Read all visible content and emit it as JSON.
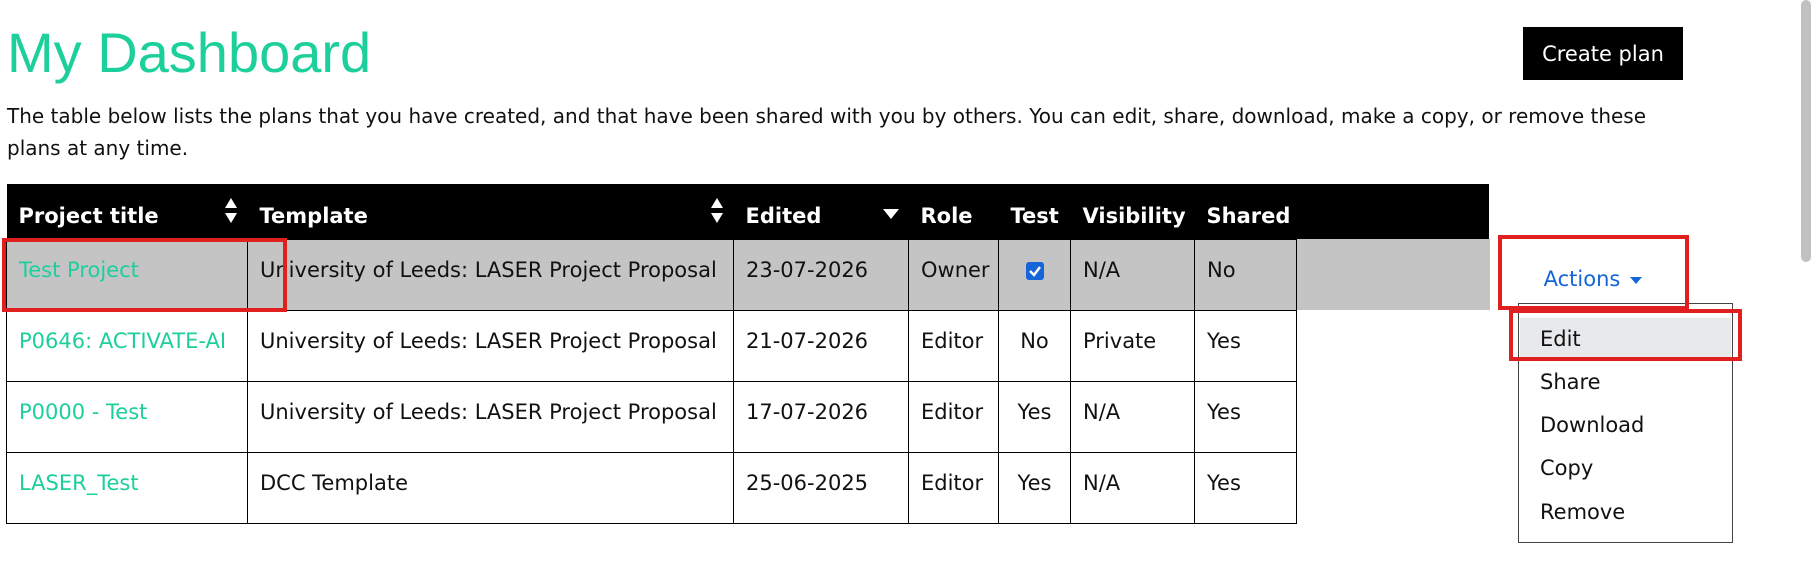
{
  "page": {
    "title": "My Dashboard",
    "create_button": "Create plan",
    "intro": "The table below lists the plans that you have created, and that have been shared with you by others. You can edit, share, download, make a copy, or remove these plans at any time."
  },
  "table": {
    "headers": {
      "project_title": "Project title",
      "template": "Template",
      "edited": "Edited",
      "role": "Role",
      "test": "Test",
      "visibility": "Visibility",
      "shared": "Shared"
    },
    "rows": [
      {
        "title": "Test Project",
        "template": "University of Leeds: LASER Project Proposal",
        "edited": "23-07-2026",
        "role": "Owner",
        "test": "",
        "test_checked": true,
        "visibility": "N/A",
        "shared": "No"
      },
      {
        "title": "P0646: ACTIVATE-AI",
        "template": "University of Leeds: LASER Project Proposal",
        "edited": "21-07-2026",
        "role": "Editor",
        "test": "No",
        "visibility": "Private",
        "shared": "Yes"
      },
      {
        "title": "P0000 - Test",
        "template": "University of Leeds: LASER Project Proposal",
        "edited": "17-07-2026",
        "role": "Editor",
        "test": "Yes",
        "visibility": "N/A",
        "shared": "Yes"
      },
      {
        "title": "LASER_Test",
        "template": "DCC Template",
        "edited": "25-06-2025",
        "role": "Editor",
        "test": "Yes",
        "visibility": "N/A",
        "shared": "Yes"
      }
    ]
  },
  "actions": {
    "label": "Actions",
    "menu": [
      "Edit",
      "Share",
      "Download",
      "Copy",
      "Remove"
    ],
    "active_item": "Edit"
  },
  "colors": {
    "brand_green": "#1ccf9b",
    "link_blue": "#1565d8",
    "highlight_red": "#e0201f",
    "selected_row": "#c4c4c4"
  },
  "icons": [
    "sort-icon",
    "sort-descending-icon",
    "checkbox-checked-icon",
    "caret-down-icon"
  ]
}
